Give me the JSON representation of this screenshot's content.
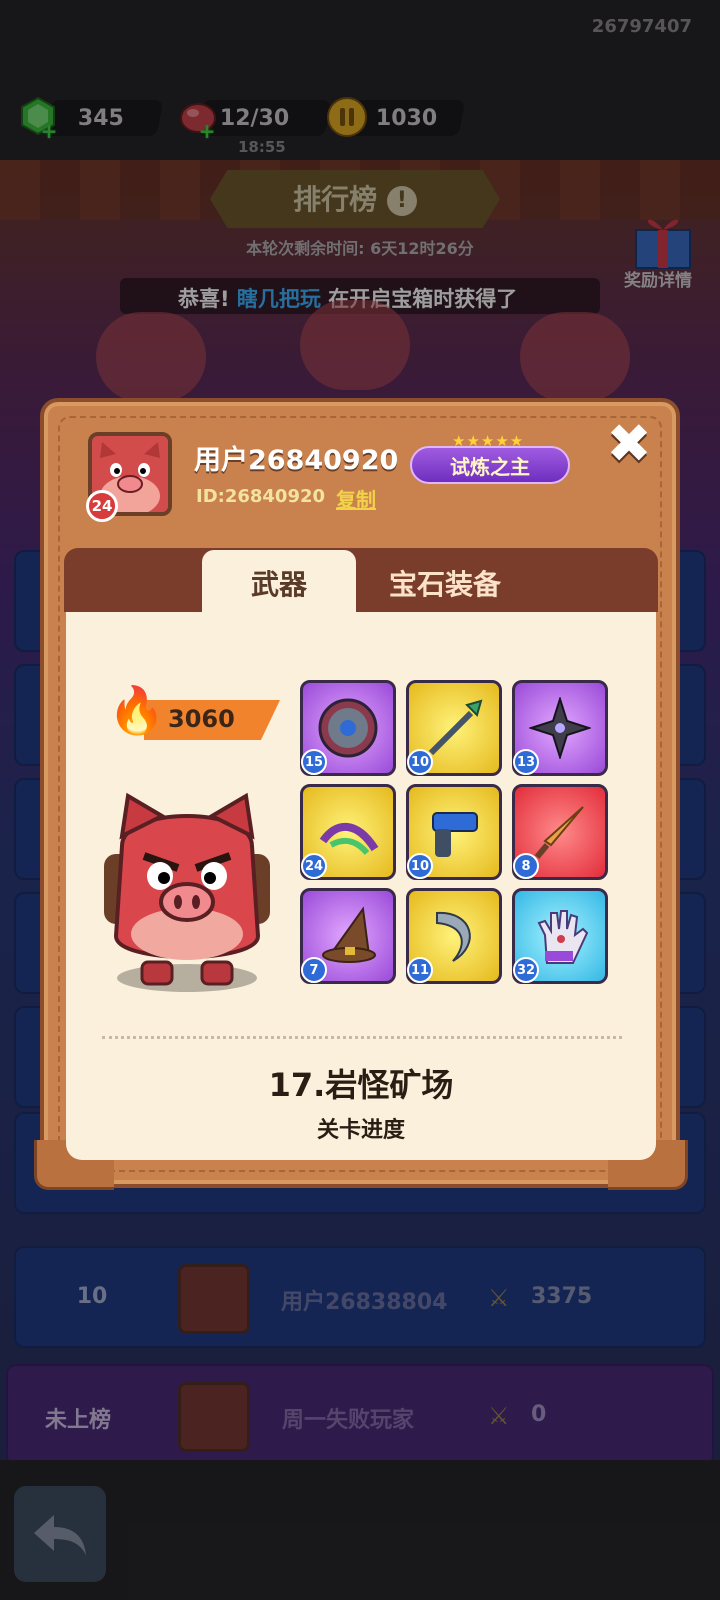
{
  "top_bar": {
    "account_id": "26797407",
    "gems": "345",
    "energy": "12/30",
    "energy_timer": "18:55",
    "coins": "1030"
  },
  "leaderboard": {
    "title": "排行榜",
    "season_time": "本轮次剩余时间:  6天12时26分",
    "reward_details": "奖励详情",
    "ticker_prefix": "恭喜!",
    "ticker_name": "瞎几把玩",
    "ticker_suffix": "在开启宝箱时获得了",
    "rows": [
      {
        "rank": "10",
        "name": "用户26838804",
        "score": "3375"
      },
      {
        "rank": "未上榜",
        "name": "周一失败玩家",
        "score": "0"
      }
    ]
  },
  "profile": {
    "username": "用户26840920",
    "id_text": "ID:26840920",
    "copy_label": "复制",
    "level": "24",
    "title_badge": "试炼之主",
    "tabs": [
      "武器",
      "宝石装备"
    ],
    "power": "3060",
    "weapons": [
      {
        "icon": "round-shield-icon",
        "level": "15",
        "rarity": "purple"
      },
      {
        "icon": "spear-icon",
        "level": "10",
        "rarity": "yellow"
      },
      {
        "icon": "shuriken-icon",
        "level": "13",
        "rarity": "purple"
      },
      {
        "icon": "dragon-bow-icon",
        "level": "24",
        "rarity": "yellow"
      },
      {
        "icon": "revolver-icon",
        "level": "10",
        "rarity": "yellow"
      },
      {
        "icon": "dagger-icon",
        "level": "8",
        "rarity": "red"
      },
      {
        "icon": "wizard-hat-icon",
        "level": "7",
        "rarity": "purple"
      },
      {
        "icon": "scythe-icon",
        "level": "11",
        "rarity": "yellow"
      },
      {
        "icon": "glove-icon",
        "level": "32",
        "rarity": "blue"
      }
    ],
    "stage_name": "17.岩怪矿场",
    "stage_label": "关卡进度"
  },
  "colors": {
    "modal_bg": "#c9824d",
    "panel_bg": "#fbf0dc",
    "accent_orange": "#f1832c",
    "name_blue": "#3fb4ff"
  }
}
